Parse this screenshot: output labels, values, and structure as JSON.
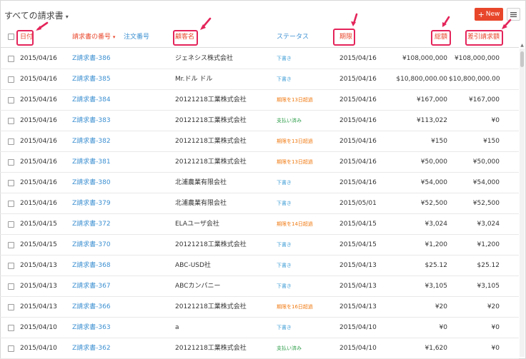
{
  "header": {
    "title": "すべての請求書",
    "title_caret": "▾",
    "new_button_plus": "+",
    "new_button_label": "New"
  },
  "columns": {
    "date": "日付",
    "invoice_no": "請求書の番号",
    "invoice_sort": "▾",
    "order_no": "注文番号",
    "customer": "顧客名",
    "status": "ステータス",
    "due": "期限",
    "total": "総額",
    "balance": "差引請求額"
  },
  "colors": {
    "accent_red": "#e8462b",
    "link_blue": "#3b8fd1",
    "highlight_pink": "#e4245a",
    "status_draft": "#4aa3d8",
    "status_overdue": "#f07a12",
    "status_paid": "#2e9e4a"
  },
  "icons": {
    "new": "plus-icon",
    "menu": "hamburger-menu-icon",
    "sort": "caret-down-icon"
  },
  "rows": [
    {
      "date": "2015/04/16",
      "invoice": "Z請求書-386",
      "customer": "ジェネシス株式会社",
      "status": "下書き",
      "status_type": "draft",
      "due": "2015/04/16",
      "total": "¥108,000,000",
      "balance": "¥108,000,000"
    },
    {
      "date": "2015/04/16",
      "invoice": "Z請求書-385",
      "customer": "Mr.ドル ドル",
      "status": "下書き",
      "status_type": "draft",
      "due": "2015/04/16",
      "total": "$10,800,000.00",
      "balance": "$10,800,000.00"
    },
    {
      "date": "2015/04/16",
      "invoice": "Z請求書-384",
      "customer": "20121218工業株式会社",
      "status": "期限を13日超過",
      "status_type": "overdue",
      "due": "2015/04/16",
      "total": "¥167,000",
      "balance": "¥167,000"
    },
    {
      "date": "2015/04/16",
      "invoice": "Z請求書-383",
      "customer": "20121218工業株式会社",
      "status": "支払い済み",
      "status_type": "paid",
      "due": "2015/04/16",
      "total": "¥113,022",
      "balance": "¥0"
    },
    {
      "date": "2015/04/16",
      "invoice": "Z請求書-382",
      "customer": "20121218工業株式会社",
      "status": "期限を13日超過",
      "status_type": "overdue",
      "due": "2015/04/16",
      "total": "¥150",
      "balance": "¥150"
    },
    {
      "date": "2015/04/16",
      "invoice": "Z請求書-381",
      "customer": "20121218工業株式会社",
      "status": "期限を13日超過",
      "status_type": "overdue",
      "due": "2015/04/16",
      "total": "¥50,000",
      "balance": "¥50,000"
    },
    {
      "date": "2015/04/16",
      "invoice": "Z請求書-380",
      "customer": "北浦農業有限会社",
      "status": "下書き",
      "status_type": "draft",
      "due": "2015/04/16",
      "total": "¥54,000",
      "balance": "¥54,000"
    },
    {
      "date": "2015/04/16",
      "invoice": "Z請求書-379",
      "customer": "北浦農業有限会社",
      "status": "下書き",
      "status_type": "draft",
      "due": "2015/05/01",
      "total": "¥52,500",
      "balance": "¥52,500"
    },
    {
      "date": "2015/04/15",
      "invoice": "Z請求書-372",
      "customer": "ELAユーザ会社",
      "status": "期限を14日超過",
      "status_type": "overdue",
      "due": "2015/04/15",
      "total": "¥3,024",
      "balance": "¥3,024"
    },
    {
      "date": "2015/04/15",
      "invoice": "Z請求書-370",
      "customer": "20121218工業株式会社",
      "status": "下書き",
      "status_type": "draft",
      "due": "2015/04/15",
      "total": "¥1,200",
      "balance": "¥1,200"
    },
    {
      "date": "2015/04/13",
      "invoice": "Z請求書-368",
      "customer": "ABC-USD社",
      "status": "下書き",
      "status_type": "draft",
      "due": "2015/04/13",
      "total": "$25.12",
      "balance": "$25.12"
    },
    {
      "date": "2015/04/13",
      "invoice": "Z請求書-367",
      "customer": "ABCカンパニー",
      "status": "下書き",
      "status_type": "draft",
      "due": "2015/04/13",
      "total": "¥3,105",
      "balance": "¥3,105"
    },
    {
      "date": "2015/04/13",
      "invoice": "Z請求書-366",
      "customer": "20121218工業株式会社",
      "status": "期限を16日超過",
      "status_type": "overdue",
      "due": "2015/04/13",
      "total": "¥20",
      "balance": "¥20"
    },
    {
      "date": "2015/04/10",
      "invoice": "Z請求書-363",
      "customer": "a",
      "status": "下書き",
      "status_type": "draft",
      "due": "2015/04/10",
      "total": "¥0",
      "balance": "¥0"
    },
    {
      "date": "2015/04/10",
      "invoice": "Z請求書-362",
      "customer": "20121218工業株式会社",
      "status": "支払い済み",
      "status_type": "paid",
      "due": "2015/04/10",
      "total": "¥1,620",
      "balance": "¥0"
    }
  ]
}
